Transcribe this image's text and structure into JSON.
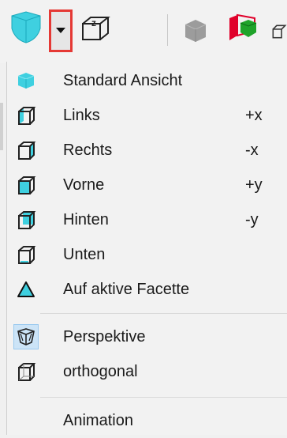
{
  "toolbar": {
    "icons": [
      "cyan-shield-icon",
      "dropdown-arrow-icon",
      "z-axis-view-icon",
      "gray-cube-icon",
      "red-green-cube-icon",
      "partial-cube-icon"
    ]
  },
  "menu": {
    "items": [
      {
        "label": "Standard Ansicht",
        "shortcut": "",
        "icon": "cyan-cube-icon"
      },
      {
        "label": "Links",
        "shortcut": "+x",
        "icon": "cube-left-icon"
      },
      {
        "label": "Rechts",
        "shortcut": "-x",
        "icon": "cube-right-icon"
      },
      {
        "label": "Vorne",
        "shortcut": "+y",
        "icon": "cube-front-icon"
      },
      {
        "label": "Hinten",
        "shortcut": "-y",
        "icon": "cube-back-icon"
      },
      {
        "label": "Unten",
        "shortcut": "",
        "icon": "cube-bottom-icon"
      },
      {
        "label": "Auf aktive Facette",
        "shortcut": "",
        "icon": "triangle-icon"
      },
      {
        "label": "Perspektive",
        "shortcut": "",
        "icon": "perspective-cube-icon"
      },
      {
        "label": "orthogonal",
        "shortcut": "",
        "icon": "orthogonal-cube-icon"
      },
      {
        "label": "Animation",
        "shortcut": "",
        "icon": ""
      }
    ]
  },
  "colors": {
    "accent_cyan": "#3fd0e0",
    "highlight_red": "#e53935",
    "selected_bg": "#cce4f7"
  }
}
